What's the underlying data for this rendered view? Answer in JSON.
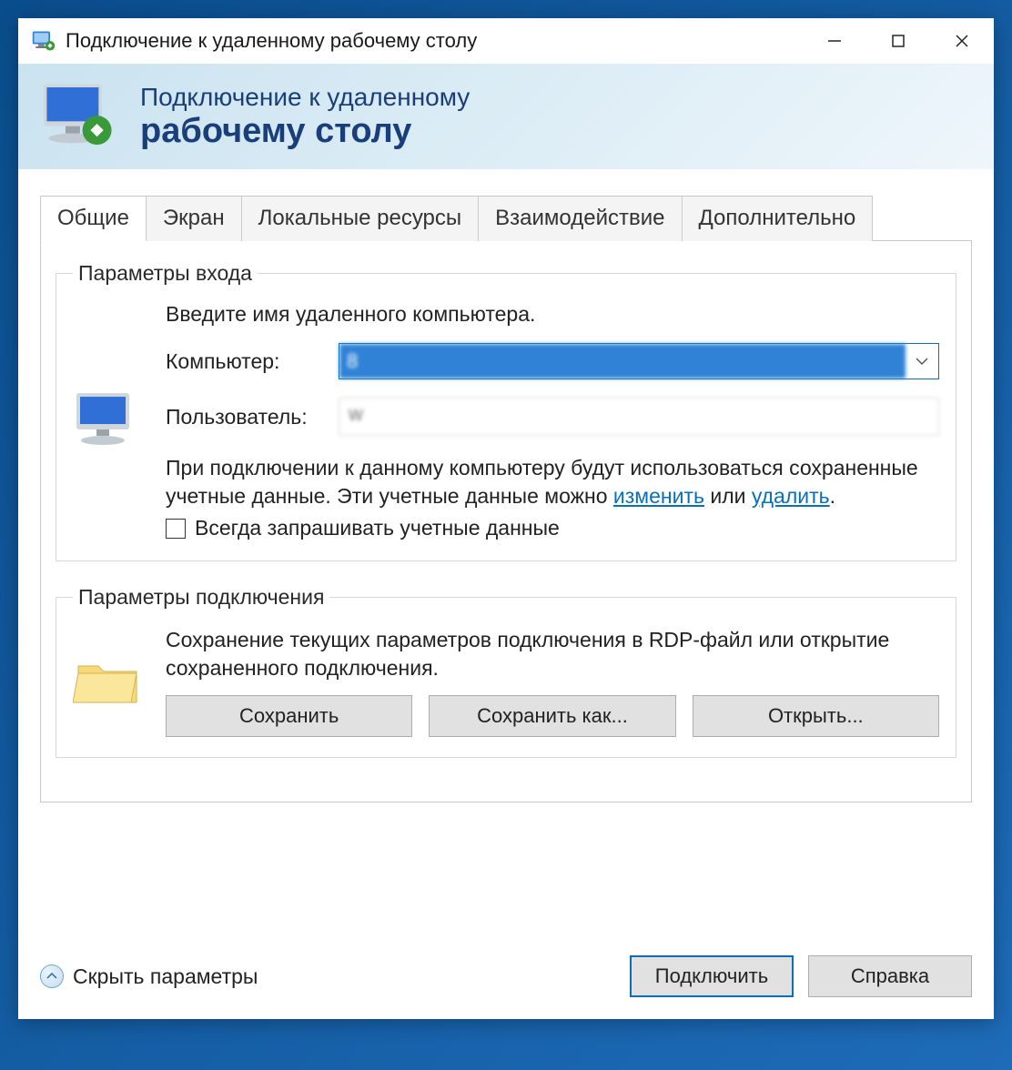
{
  "window": {
    "title": "Подключение к удаленному рабочему столу"
  },
  "banner": {
    "line1": "Подключение к удаленному",
    "line2": "рабочему столу"
  },
  "tabs": [
    {
      "label": "Общие",
      "active": true
    },
    {
      "label": "Экран",
      "active": false
    },
    {
      "label": "Локальные ресурсы",
      "active": false
    },
    {
      "label": "Взаимодействие",
      "active": false
    },
    {
      "label": "Дополнительно",
      "active": false
    }
  ],
  "login_group": {
    "legend": "Параметры входа",
    "intro": "Введите имя удаленного компьютера.",
    "computer_label": "Компьютер:",
    "computer_value": "8",
    "user_label": "Пользователь:",
    "user_value": "w",
    "note_pre": "При подключении к данному компьютеру будут использоваться сохраненные учетные данные.  Эти учетные данные можно ",
    "note_link_change": "изменить",
    "note_mid": " или ",
    "note_link_delete": "удалить",
    "note_post": ".",
    "checkbox_label": "Всегда запрашивать учетные данные"
  },
  "conn_group": {
    "legend": "Параметры подключения",
    "desc": "Сохранение текущих параметров подключения в RDP-файл или открытие сохраненного подключения.",
    "save": "Сохранить",
    "save_as": "Сохранить как...",
    "open": "Открыть..."
  },
  "footer": {
    "collapse": "Скрыть параметры",
    "connect": "Подключить",
    "help": "Справка"
  }
}
